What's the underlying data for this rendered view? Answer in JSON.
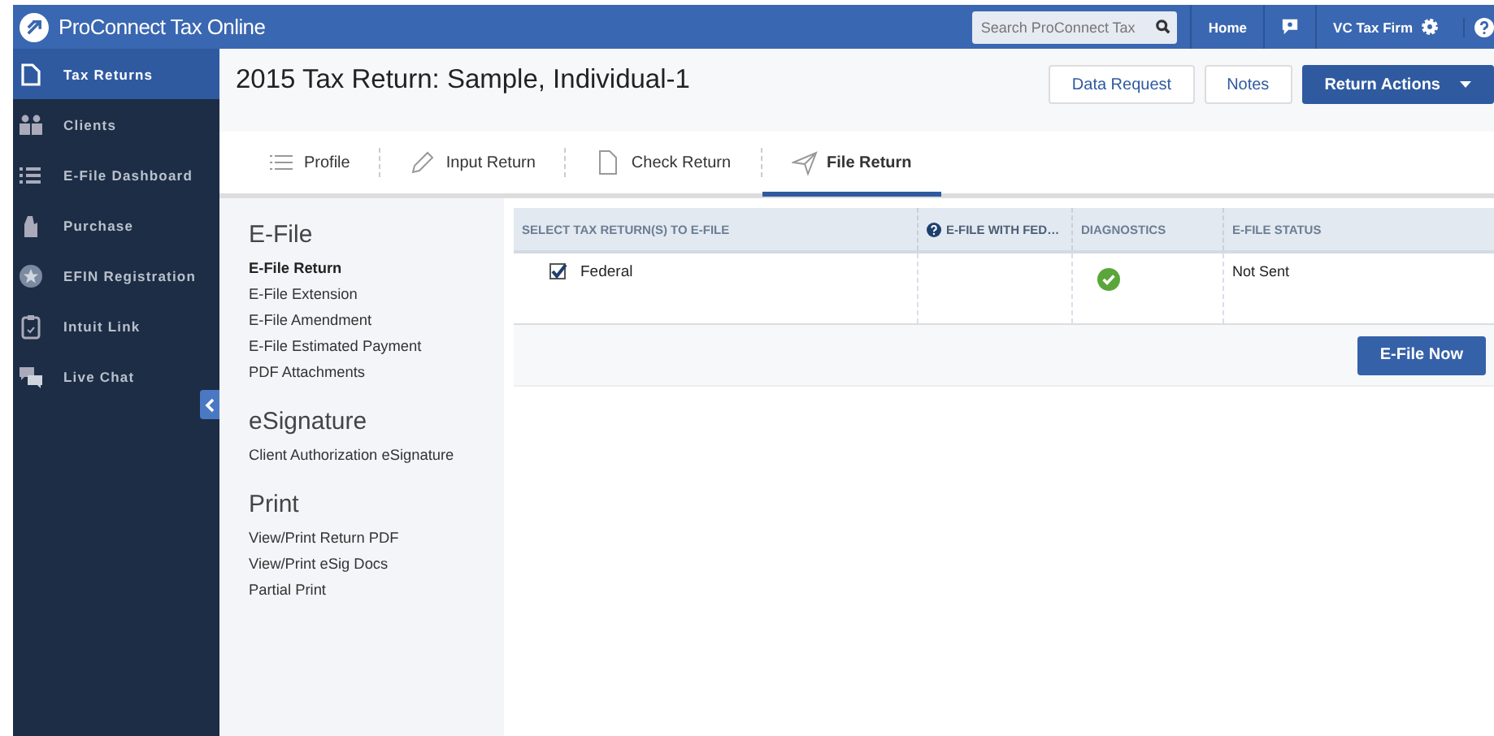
{
  "app": {
    "title": "ProConnect Tax Online"
  },
  "topbar": {
    "search": {
      "placeholder": "Search ProConnect Tax"
    },
    "home": "Home",
    "firm": "VC Tax Firm"
  },
  "sidebar": {
    "items": [
      {
        "label": "Tax Returns",
        "selected": true
      },
      {
        "label": "Clients",
        "selected": false
      },
      {
        "label": "E-File Dashboard",
        "selected": false
      },
      {
        "label": "Purchase",
        "selected": false
      },
      {
        "label": "EFIN Registration",
        "selected": false
      },
      {
        "label": "Intuit Link",
        "selected": false
      },
      {
        "label": "Live Chat",
        "selected": false
      }
    ]
  },
  "header": {
    "title": "2015 Tax Return: Sample, Individual-1",
    "buttons": [
      "Data Request",
      "Notes"
    ],
    "primary_button": "Return Actions"
  },
  "tabs": [
    {
      "label": "Profile",
      "selected": false
    },
    {
      "label": "Input Return",
      "selected": false
    },
    {
      "label": "Check Return",
      "selected": false
    },
    {
      "label": "File Return",
      "selected": true
    }
  ],
  "nav": {
    "sections": [
      {
        "title": "E-File",
        "items": [
          {
            "label": "E-File Return",
            "selected": true
          },
          {
            "label": "E-File Extension",
            "selected": false
          },
          {
            "label": "E-File Amendment",
            "selected": false
          },
          {
            "label": "E-File Estimated Payment",
            "selected": false
          },
          {
            "label": "PDF Attachments",
            "selected": false
          }
        ]
      },
      {
        "title": "eSignature",
        "items": [
          {
            "label": "Client Authorization eSignature",
            "selected": false
          }
        ]
      },
      {
        "title": "Print",
        "items": [
          {
            "label": "View/Print Return PDF",
            "selected": false
          },
          {
            "label": "View/Print eSig Docs",
            "selected": false
          },
          {
            "label": "Partial Print",
            "selected": false
          }
        ]
      }
    ]
  },
  "table": {
    "columns": [
      "SELECT TAX RETURN(S) TO E-FILE",
      "E-FILE WITH FED…",
      "DIAGNOSTICS",
      "E-FILE STATUS"
    ],
    "rows": [
      {
        "name": "Federal",
        "checked": true,
        "diagnostics_passed": true,
        "status": "Not Sent"
      }
    ]
  },
  "action_button": "E-File Now"
}
